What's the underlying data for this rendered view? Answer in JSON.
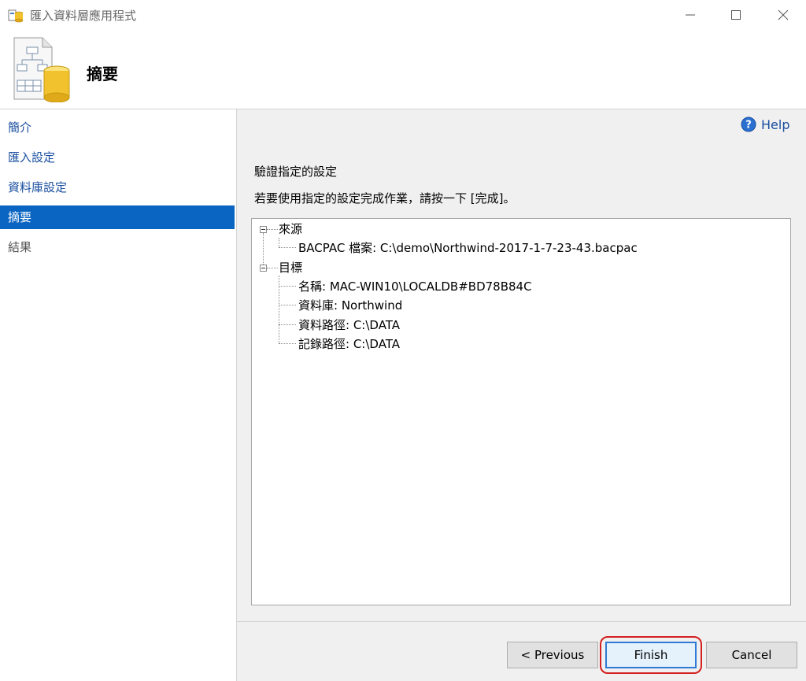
{
  "window": {
    "title": "匯入資料層應用程式"
  },
  "header": {
    "title": "摘要"
  },
  "nav": {
    "items": [
      {
        "label": "簡介"
      },
      {
        "label": "匯入設定"
      },
      {
        "label": "資料庫設定"
      },
      {
        "label": "摘要"
      },
      {
        "label": "結果"
      }
    ],
    "selected": "摘要"
  },
  "main": {
    "help_label": "Help",
    "section_title": "驗證指定的設定",
    "instruction": "若要使用指定的設定完成作業，請按一下 [完成]。",
    "tree": {
      "source": {
        "label": "來源",
        "children": [
          "BACPAC 檔案: C:\\demo\\Northwind-2017-1-7-23-43.bacpac"
        ]
      },
      "target": {
        "label": "目標",
        "children": [
          "名稱: MAC-WIN10\\LOCALDB#BD78B84C",
          "資料庫: Northwind",
          "資料路徑: C:\\DATA",
          "記錄路徑: C:\\DATA"
        ]
      }
    }
  },
  "buttons": {
    "previous": "< Previous",
    "finish": "Finish",
    "cancel": "Cancel"
  },
  "colors": {
    "accent": "#0a64c2",
    "link": "#1a4fa0",
    "highlight_ring": "#d42020"
  }
}
